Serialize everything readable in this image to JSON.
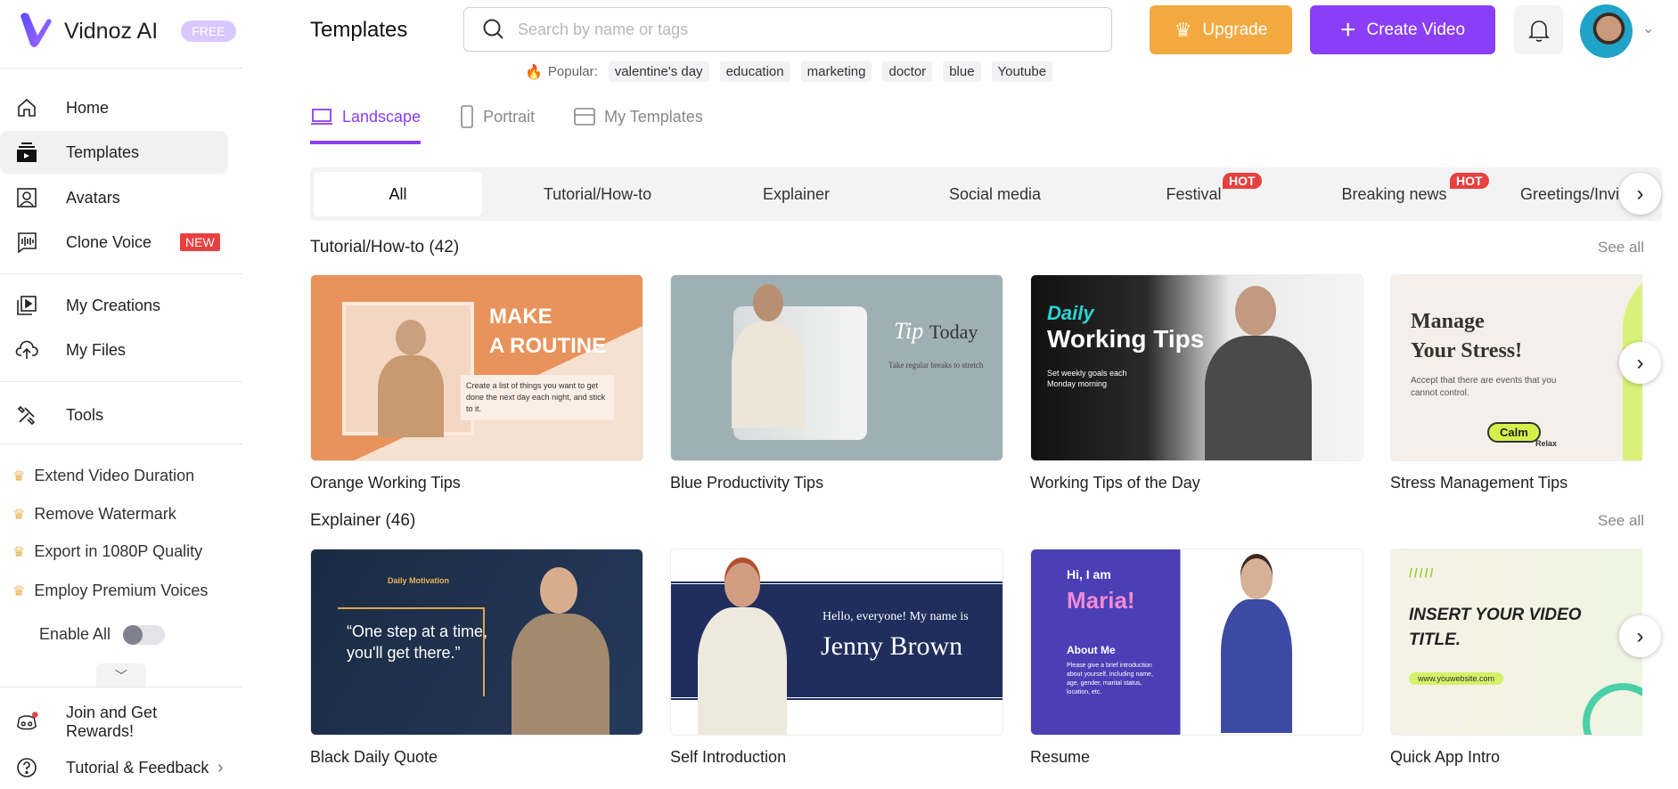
{
  "app": {
    "name": "Vidnoz AI",
    "plan_badge": "FREE"
  },
  "sidebar": {
    "items": [
      {
        "label": "Home",
        "icon": "home-icon"
      },
      {
        "label": "Templates",
        "icon": "templates-icon",
        "active": true
      },
      {
        "label": "Avatars",
        "icon": "avatar-icon"
      },
      {
        "label": "Clone Voice",
        "icon": "voice-icon",
        "badge": "NEW"
      },
      {
        "label": "My Creations",
        "icon": "creations-icon"
      },
      {
        "label": "My Files",
        "icon": "upload-cloud-icon"
      },
      {
        "label": "Tools",
        "icon": "tools-icon"
      }
    ],
    "perks": [
      "Extend Video Duration",
      "Remove Watermark",
      "Export in 1080P Quality",
      "Employ Premium Voices"
    ],
    "enable_all": {
      "label": "Enable All",
      "on": false
    },
    "bottom": [
      {
        "label": "Join and Get Rewards!",
        "icon": "discord-icon"
      },
      {
        "label": "Tutorial & Feedback",
        "icon": "help-icon"
      }
    ]
  },
  "header": {
    "title": "Templates",
    "search_placeholder": "Search by name or tags",
    "popular_label": "Popular:",
    "popular_tags": [
      "valentine's day",
      "education",
      "marketing",
      "doctor",
      "blue",
      "Youtube"
    ],
    "upgrade": "Upgrade",
    "create_video": "Create Video",
    "colors": {
      "upgrade": "#f2aa40",
      "create": "#8a3ef5"
    }
  },
  "tabs": [
    {
      "label": "Landscape",
      "active": true
    },
    {
      "label": "Portrait"
    },
    {
      "label": "My Templates"
    }
  ],
  "categories": [
    {
      "label": "All",
      "active": true
    },
    {
      "label": "Tutorial/How-to"
    },
    {
      "label": "Explainer"
    },
    {
      "label": "Social media"
    },
    {
      "label": "Festival",
      "badge": "HOT"
    },
    {
      "label": "Breaking news",
      "badge": "HOT"
    },
    {
      "label": "Greetings/Invi"
    }
  ],
  "sections": [
    {
      "title": "Tutorial/How-to (42)",
      "see_all": "See all",
      "cards": [
        {
          "title": "Orange Working Tips",
          "thumb": {
            "heading1": "MAKE",
            "heading2": "A ROUTINE",
            "body": "Create a list of things you want to get done the next day each night, and stick to it."
          }
        },
        {
          "title": "Blue Productivity Tips",
          "thumb": {
            "heading1": "Tip",
            "heading2": "Today",
            "body": "Take regular breaks to stretch"
          }
        },
        {
          "title": "Working Tips of the Day",
          "thumb": {
            "heading1": "Daily",
            "heading2": "Working Tips",
            "body": "Set weekly goals each Monday morning"
          }
        },
        {
          "title": "Stress Management Tips",
          "thumb": {
            "heading1": "Manage",
            "heading2": "Your Stress!",
            "body": "Accept that there are events that you cannot control.",
            "tag1": "Calm",
            "tag2": "Relax"
          }
        }
      ]
    },
    {
      "title": "Explainer (46)",
      "see_all": "See all",
      "cards": [
        {
          "title": "Black Daily Quote",
          "thumb": {
            "heading1": "Daily Motivation",
            "body": "“One step at a time, you'll get there.”"
          }
        },
        {
          "title": "Self Introduction",
          "thumb": {
            "heading1": "Hello, everyone! My name is",
            "heading2": "Jenny Brown"
          }
        },
        {
          "title": "Resume",
          "thumb": {
            "heading1": "Hi, I am",
            "heading2": "Maria!",
            "sub": "About Me",
            "body": "Please give a brief introduction about yourself, including name, age, gender, marital status, location, etc."
          }
        },
        {
          "title": "Quick App Intro",
          "thumb": {
            "heading1": "INSERT YOUR VIDEO TITLE.",
            "body": "www.youwebsite.com"
          }
        }
      ]
    }
  ]
}
